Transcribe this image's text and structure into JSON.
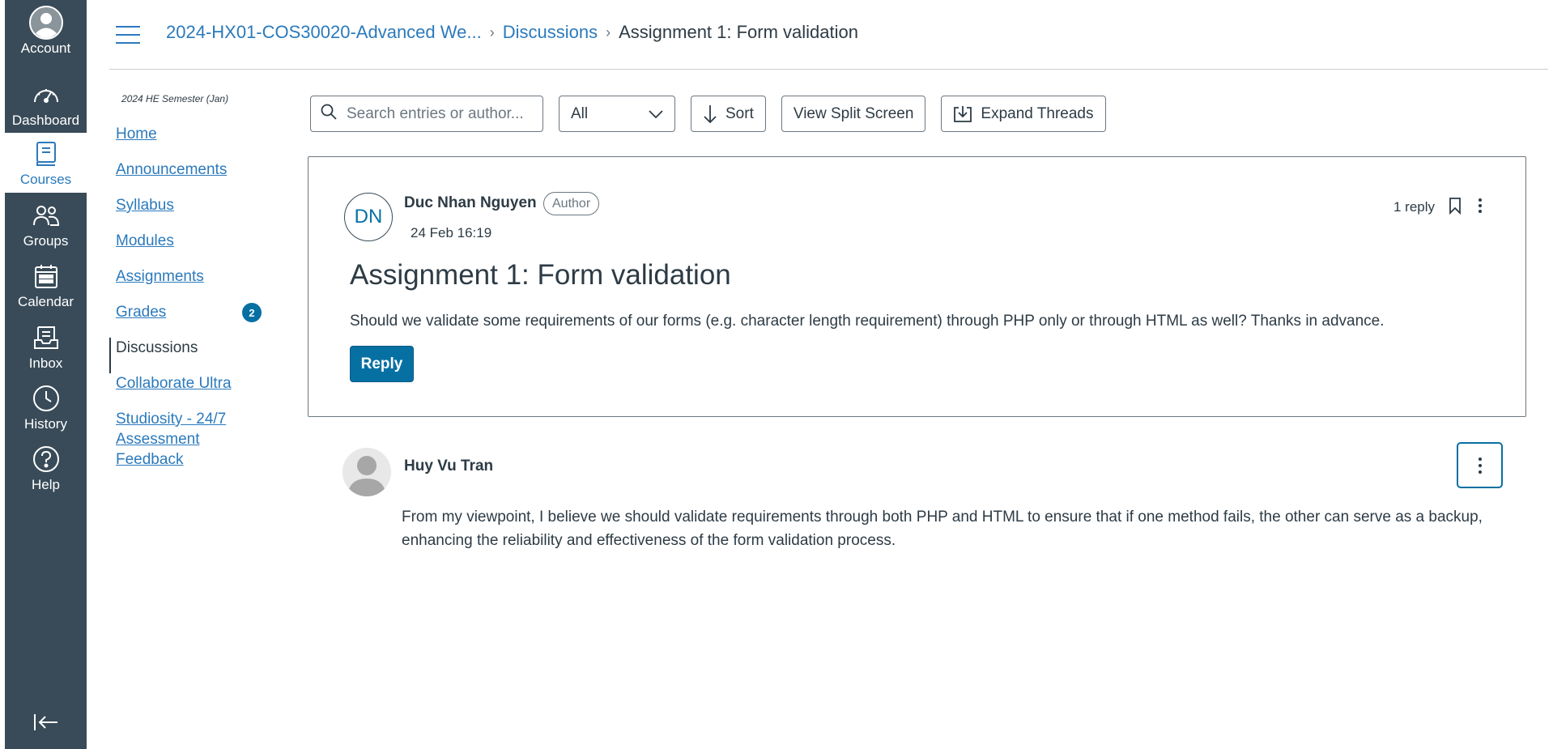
{
  "global_nav": {
    "items": [
      {
        "label": "Account",
        "icon": "account-icon"
      },
      {
        "label": "Dashboard",
        "icon": "dashboard-icon"
      },
      {
        "label": "Courses",
        "icon": "courses-icon"
      },
      {
        "label": "Groups",
        "icon": "groups-icon"
      },
      {
        "label": "Calendar",
        "icon": "calendar-icon"
      },
      {
        "label": "Inbox",
        "icon": "inbox-icon"
      },
      {
        "label": "History",
        "icon": "history-icon"
      },
      {
        "label": "Help",
        "icon": "help-icon"
      }
    ],
    "active": "Courses",
    "background": "#394b58"
  },
  "header": {
    "breadcrumb": {
      "course": "2024-HX01-COS30020-Advanced We...",
      "section": "Discussions",
      "current": "Assignment 1: Form validation"
    }
  },
  "course_nav": {
    "term": "2024 HE Semester (Jan)",
    "items": [
      {
        "label": "Home"
      },
      {
        "label": "Announcements"
      },
      {
        "label": "Syllabus"
      },
      {
        "label": "Modules"
      },
      {
        "label": "Assignments"
      },
      {
        "label": "Grades",
        "badge": "2"
      },
      {
        "label": "Discussions",
        "active": true
      },
      {
        "label": "Collaborate Ultra"
      },
      {
        "label": "Studiosity - 24/7 Assessment Feedback"
      }
    ]
  },
  "toolbar": {
    "search_placeholder": "Search entries or author...",
    "filter_value": "All",
    "sort_label": "Sort",
    "split_screen_label": "View Split Screen",
    "expand_threads_label": "Expand Threads"
  },
  "topic": {
    "initials": "DN",
    "author": "Duc Nhan Nguyen",
    "author_pill": "Author",
    "date": "24 Feb 16:19",
    "reply_count": "1 reply",
    "title": "Assignment 1: Form validation",
    "body": "Should we validate some requirements of our forms (e.g. character length requirement) through PHP only or through HTML as well? Thanks in advance.",
    "reply_label": "Reply"
  },
  "reply": {
    "author": "Huy Vu Tran",
    "body": "From my viewpoint, I believe we should validate requirements through both PHP and HTML to ensure that if one method fails, the other can serve as a backup, enhancing the reliability and effectiveness of the form validation process."
  },
  "colors": {
    "link": "#2b7abc",
    "primary_button": "#0770a3",
    "text": "#2d3b45"
  }
}
